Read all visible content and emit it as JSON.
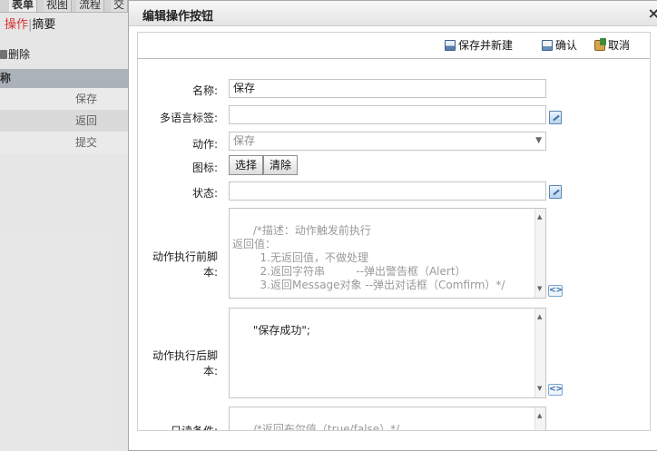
{
  "background": {
    "tabs": [
      "表单",
      "视图",
      "流程",
      "交"
    ],
    "subtabs": {
      "active": "操作",
      "other": "摘要"
    },
    "toolbar_delete": "删除",
    "table_header": "称",
    "rows": [
      "保存",
      "返回",
      "提交"
    ]
  },
  "dialog": {
    "title": "编辑操作按钮",
    "close_glyph": "×",
    "buttons": {
      "save_new": "保存并新建",
      "confirm": "确认",
      "cancel": "取消"
    },
    "form": {
      "name": {
        "label": "名称:",
        "value": "保存"
      },
      "i18n_tag": {
        "label": "多语言标签:",
        "value": ""
      },
      "action": {
        "label": "动作:",
        "value": "保存"
      },
      "icon": {
        "label": "图标:",
        "choose": "选择",
        "clear": "清除"
      },
      "state": {
        "label": "状态:",
        "value": ""
      },
      "before_script": {
        "label": "动作执行前脚本:",
        "placeholder": "/*描述：动作触发前执行\n返回值：\n        1.无返回值，不做处理\n        2.返回字符串         --弹出警告框（Alert）\n        3.返回Message对象 --弹出对话框（Comfirm）*/"
      },
      "after_script": {
        "label": "动作执行后脚本:",
        "value": "\"保存成功\";"
      },
      "readonly_cond": {
        "label": "只读条件:",
        "placeholder": "/*返回布尔值（true/false）*/"
      }
    }
  }
}
